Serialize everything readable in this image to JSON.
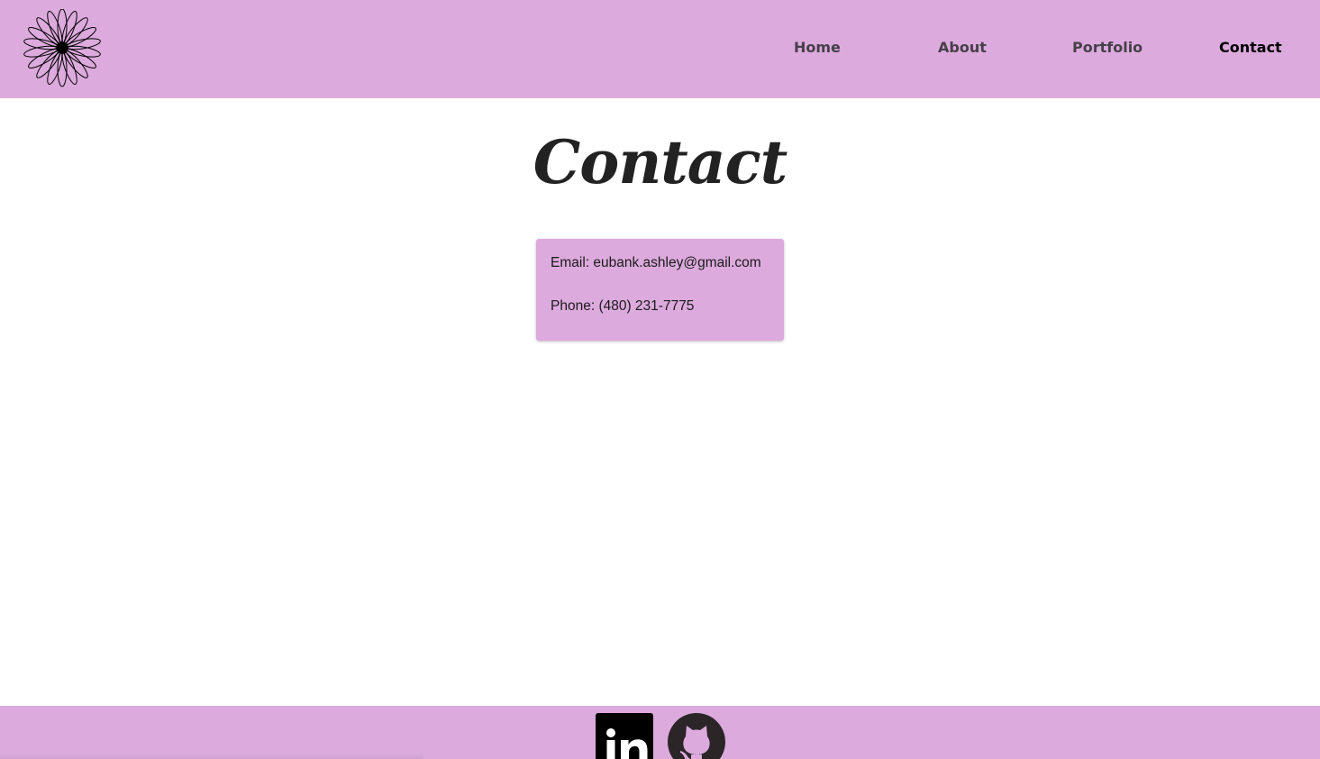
{
  "nav": {
    "logo": "flower-logo",
    "items": [
      {
        "label": "Home",
        "active": false
      },
      {
        "label": "About",
        "active": false
      },
      {
        "label": "Portfolio",
        "active": false
      },
      {
        "label": "Contact",
        "active": true
      }
    ]
  },
  "main": {
    "title": "Contact",
    "contact": {
      "email_label": "Email: ",
      "email": "eubank.ashley@gmail.com",
      "phone_label": "Phone: ",
      "phone": "(480) 231-7775"
    }
  },
  "footer": {
    "icons": [
      "linkedin-icon",
      "github-icon"
    ]
  },
  "colors": {
    "accent": "#dcaadd",
    "title": "#222222",
    "nav_text": "#47404a",
    "nav_active": "#000000"
  }
}
